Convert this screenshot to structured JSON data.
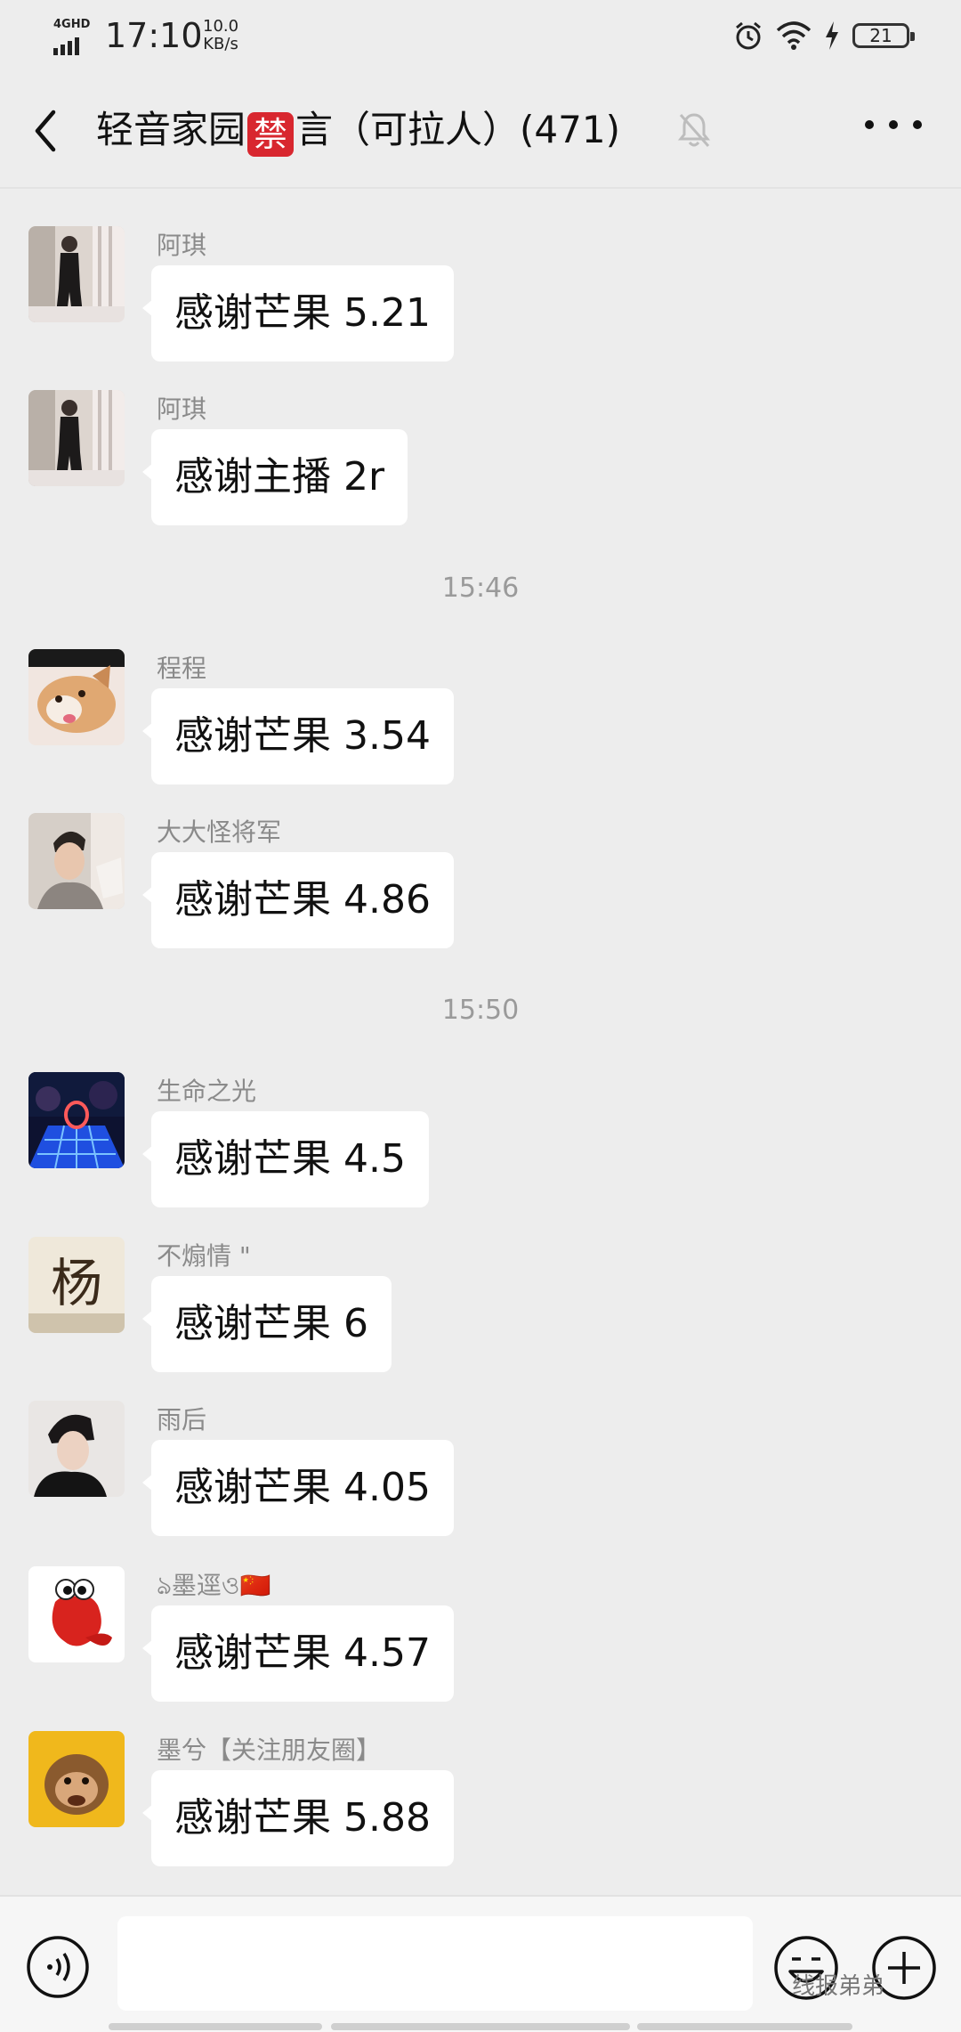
{
  "status_bar": {
    "network": "4GHD",
    "time": "17:10",
    "speed_value": "10.0",
    "speed_unit": "KB/s",
    "battery": "21"
  },
  "header": {
    "title_prefix": "轻音家园",
    "ban_badge": "禁",
    "title_suffix": "言（可拉人）(471)"
  },
  "messages": [
    {
      "sender": "阿琪",
      "text": "感谢芒果 5.21"
    },
    {
      "sender": "阿琪",
      "text": "感谢主播 2r"
    },
    {
      "sender": "程程",
      "text": "感谢芒果 3.54"
    },
    {
      "sender": "大大怪将军",
      "text": "感谢芒果 4.86"
    },
    {
      "sender": "生命之光",
      "text": "感谢芒果 4.5"
    },
    {
      "sender": "不煽情 \"",
      "text": "感谢芒果 6"
    },
    {
      "sender": "雨后",
      "text": "感谢芒果 4.05"
    },
    {
      "sender": "ঌ墨逕ও🇨🇳",
      "text": "感谢芒果 4.57"
    },
    {
      "sender": "墨兮【关注朋友圈】",
      "text": "感谢芒果 5.88"
    }
  ],
  "timestamps": [
    "15:46",
    "15:50"
  ],
  "avatar_text": {
    "yang": "杨"
  },
  "watermark": "线报弟弟",
  "colors": {
    "background": "#ededed",
    "bubble": "#ffffff",
    "ban_badge": "#d8272f",
    "sender_name": "#8a8a8a"
  }
}
